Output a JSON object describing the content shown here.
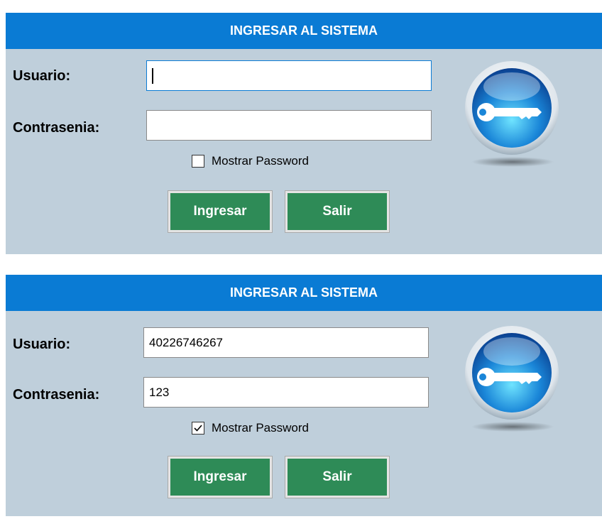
{
  "panels": [
    {
      "title": "INGRESAR AL SISTEMA",
      "usuario_label": "Usuario:",
      "usuario_value": "",
      "contrasena_label": "Contrasenia:",
      "contrasena_value": "",
      "show_password_label": "Mostrar Password",
      "show_password_checked": false,
      "login_button": "Ingresar",
      "exit_button": "Salir"
    },
    {
      "title": "INGRESAR AL SISTEMA",
      "usuario_label": "Usuario:",
      "usuario_value": "40226746267",
      "contrasena_label": "Contrasenia:",
      "contrasena_value": "123",
      "show_password_label": "Mostrar Password",
      "show_password_checked": true,
      "login_button": "Ingresar",
      "exit_button": "Salir"
    }
  ],
  "colors": {
    "title_bar": "#0a7bd4",
    "panel_bg": "#bfcfdb",
    "button_green": "#2e8b57"
  },
  "icons": {
    "key": "key-icon",
    "checkmark": "checkmark-icon"
  }
}
